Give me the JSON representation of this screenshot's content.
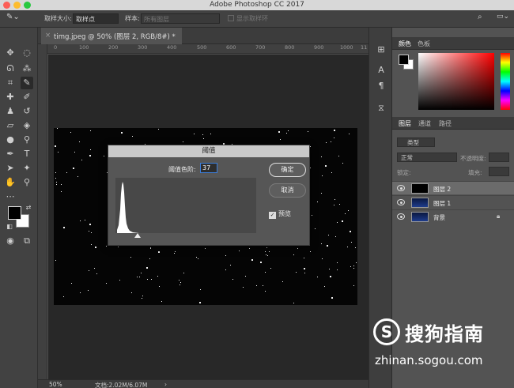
{
  "app": {
    "title": "Adobe Photoshop CC 2017"
  },
  "options": {
    "sample_size_label": "取样大小:",
    "sample_size_value": "取样点",
    "sample_label": "样本:",
    "sample_value": "所有图层",
    "ring_label": "显示取样环"
  },
  "document": {
    "tab_title": "timg.jpeg @ 50% (图层 2, RGB/8#) *",
    "close": "×"
  },
  "ruler": {
    "ticks": [
      "0",
      "100",
      "200",
      "300",
      "400",
      "500",
      "600",
      "700",
      "800",
      "900",
      "1000",
      "11"
    ]
  },
  "status": {
    "zoom": "50%",
    "doc_size": "文档:2.02M/6.07M"
  },
  "color_panel": {
    "tabs": [
      "颜色",
      "色板"
    ]
  },
  "layers_panel": {
    "tabs": [
      "图层",
      "通道",
      "路径"
    ],
    "filter_kind": "类型",
    "blend_mode": "正常",
    "opacity_label": "不透明度:",
    "lock_label": "锁定:",
    "fill_label": "填充:",
    "layers": [
      {
        "name": "图层 2",
        "selected": true
      },
      {
        "name": "图层 1",
        "selected": false
      },
      {
        "name": "背景",
        "selected": false
      }
    ]
  },
  "dialog": {
    "title": "阈值",
    "threshold_label": "阈值色阶:",
    "threshold_value": "37",
    "ok_label": "确定",
    "cancel_label": "取消",
    "preview_label": "预览",
    "preview_checked": true
  },
  "watermark": {
    "brand": "搜狗指南",
    "url": "zhinan.sogou.com"
  },
  "colors": {
    "accent_blue": "#3c7edb",
    "panel_bg": "#535353",
    "dark_bg": "#282828"
  }
}
